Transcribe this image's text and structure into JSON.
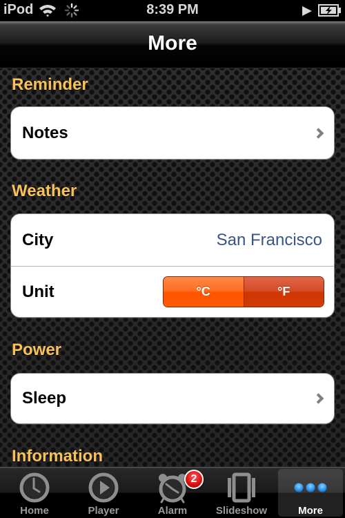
{
  "status_bar": {
    "carrier": "iPod",
    "time": "8:39 PM",
    "icons": [
      "wifi-icon",
      "activity-spinner-icon",
      "play-icon",
      "battery-charging-icon"
    ]
  },
  "nav_bar": {
    "title": "More"
  },
  "sections": [
    {
      "header": "Reminder",
      "rows": [
        {
          "label": "Notes",
          "accessory": "chevron-right-icon"
        }
      ]
    },
    {
      "header": "Weather",
      "rows": [
        {
          "label": "City",
          "value": "San Francisco"
        },
        {
          "label": "Unit",
          "control": {
            "type": "segmented",
            "options": [
              "°C",
              "°F"
            ],
            "selected": "°C"
          }
        }
      ]
    },
    {
      "header": "Power",
      "rows": [
        {
          "label": "Sleep",
          "accessory": "chevron-right-icon"
        }
      ]
    },
    {
      "header": "Information",
      "rows": []
    }
  ],
  "tab_bar": {
    "tabs": [
      {
        "label": "Home",
        "icon": "clock-icon",
        "selected": false
      },
      {
        "label": "Player",
        "icon": "play-circle-icon",
        "selected": false
      },
      {
        "label": "Alarm",
        "icon": "alarm-clock-icon",
        "selected": false,
        "badge": "2"
      },
      {
        "label": "Slideshow",
        "icon": "slideshow-icon",
        "selected": false
      },
      {
        "label": "More",
        "icon": "more-dots-icon",
        "selected": true
      }
    ]
  },
  "colors": {
    "section_header": "#f9c15a",
    "value_text": "#385487",
    "segment_selected": "#ff5a04",
    "segment_unselected": "#d23a06",
    "more_dots": "#3aa0f5",
    "badge": "#d40f0f"
  }
}
